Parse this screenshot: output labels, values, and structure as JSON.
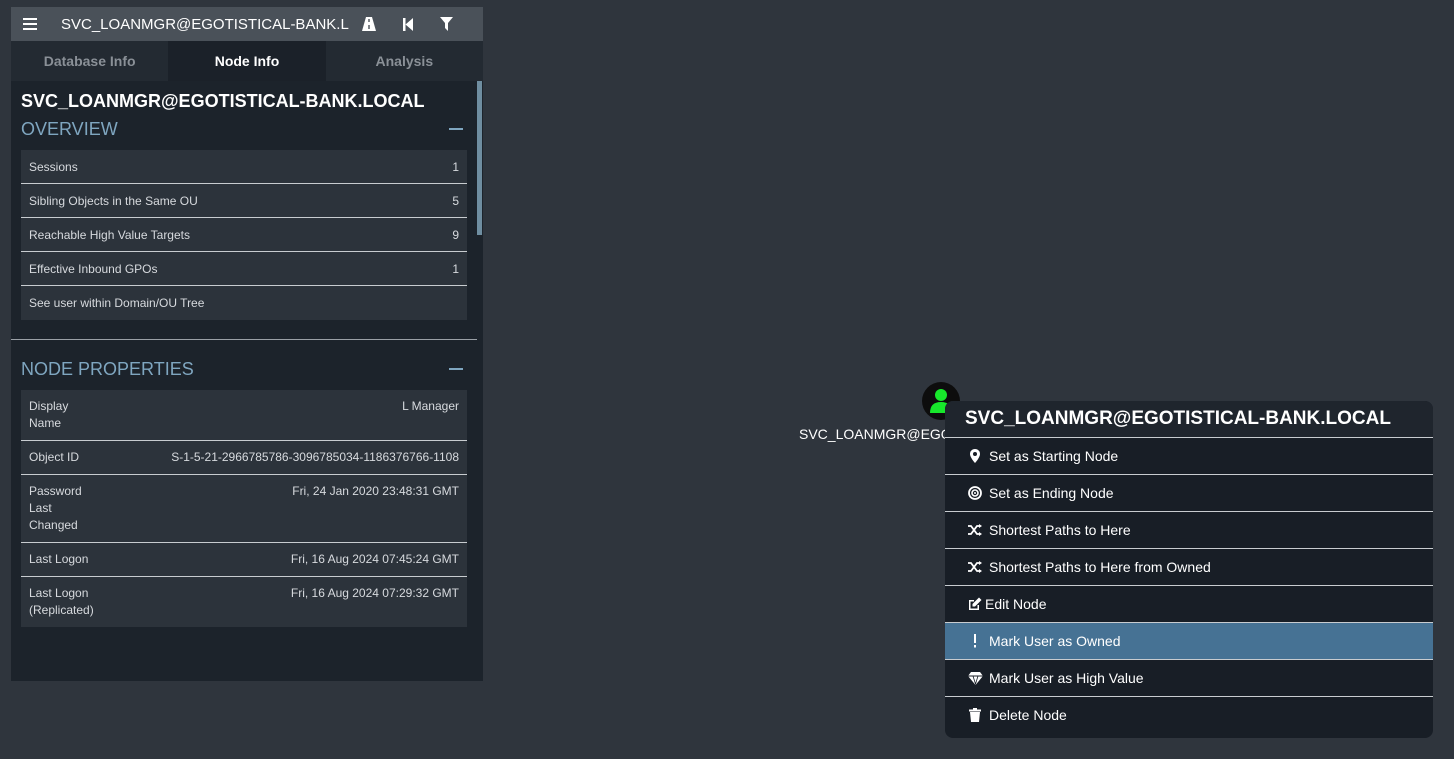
{
  "search": {
    "value": "SVC_LOANMGR@EGOTISTICAL-BANK.LOCAL"
  },
  "tabs": [
    {
      "label": "Database Info"
    },
    {
      "label": "Node Info"
    },
    {
      "label": "Analysis"
    }
  ],
  "node_info": {
    "title": "SVC_LOANMGR@EGOTISTICAL-BANK.LOCAL",
    "overview": {
      "heading": "OVERVIEW",
      "rows": [
        {
          "label": "Sessions",
          "value": "1"
        },
        {
          "label": "Sibling Objects in the Same OU",
          "value": "5"
        },
        {
          "label": "Reachable High Value Targets",
          "value": "9"
        },
        {
          "label": "Effective Inbound GPOs",
          "value": "1"
        },
        {
          "label": "See user within Domain/OU Tree",
          "value": ""
        }
      ]
    },
    "properties": {
      "heading": "NODE PROPERTIES",
      "rows": [
        {
          "key": "Display Name",
          "value": "L Manager"
        },
        {
          "key": "Object ID",
          "value": "S-1-5-21-2966785786-3096785034-1186376766-1108"
        },
        {
          "key": "Password Last Changed",
          "value": "Fri, 24 Jan 2020 23:48:31 GMT"
        },
        {
          "key": "Last Logon",
          "value": "Fri, 16 Aug 2024 07:45:24 GMT"
        },
        {
          "key": "Last Logon (Replicated)",
          "value": "Fri, 16 Aug 2024 07:29:32 GMT"
        }
      ]
    }
  },
  "graph": {
    "node_label": "SVC_LOANMGR@EGOTISTICAL-BANK.LOCAL",
    "node_color": "#17e82b"
  },
  "context_menu": {
    "title": "SVC_LOANMGR@EGOTISTICAL-BANK.LOCAL",
    "items": [
      {
        "label": "Set as Starting Node",
        "icon": "map-marker-icon"
      },
      {
        "label": "Set as Ending Node",
        "icon": "bullseye-icon"
      },
      {
        "label": "Shortest Paths to Here",
        "icon": "shuffle-icon"
      },
      {
        "label": "Shortest Paths to Here from Owned",
        "icon": "shuffle-icon"
      },
      {
        "label": "Edit Node",
        "icon": "edit-icon"
      },
      {
        "label": "Mark User as Owned",
        "icon": "exclamation-icon",
        "highlighted": true
      },
      {
        "label": "Mark User as High Value",
        "icon": "gem-icon"
      },
      {
        "label": "Delete Node",
        "icon": "trash-icon"
      }
    ]
  },
  "colors": {
    "accent": "#7fa6c0",
    "highlight": "#467294",
    "node": "#17e82b"
  }
}
